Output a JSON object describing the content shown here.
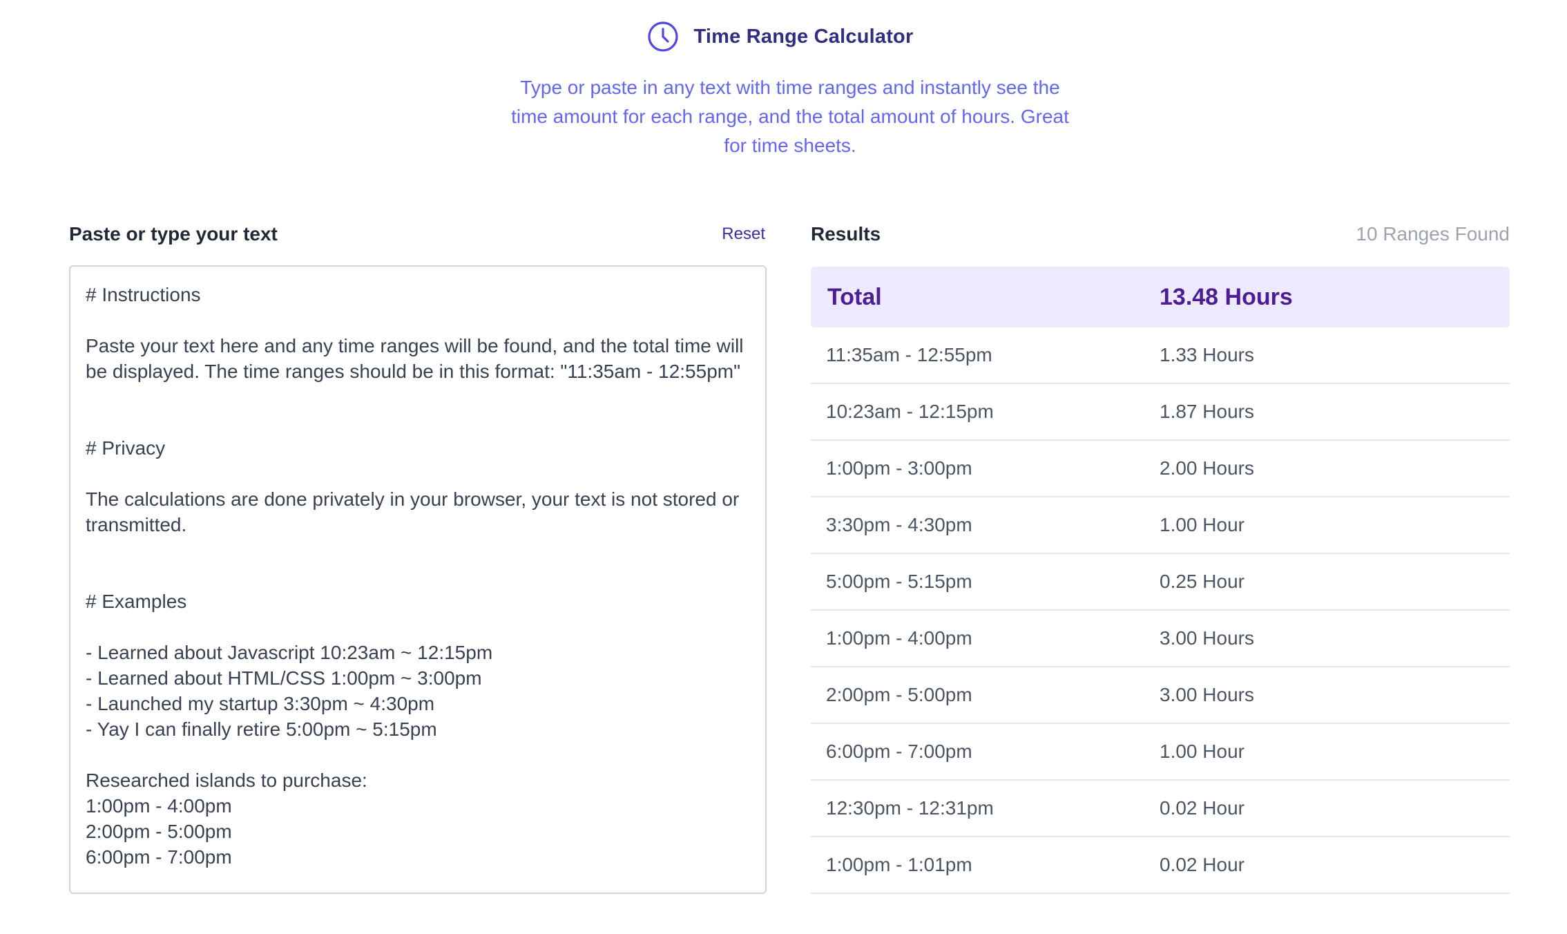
{
  "header": {
    "title": "Time Range Calculator",
    "subtitle": "Type or paste in any text with time ranges and instantly see the time amount for each range, and the total amount of hours. Great for time sheets.",
    "icon": "clock-icon",
    "accent_color": "#4f46e5"
  },
  "input_panel": {
    "title": "Paste or type your text",
    "reset_label": "Reset",
    "text": "# Instructions\n\nPaste your text here and any time ranges will be found, and the total time will be displayed. The time ranges should be in this format: \"11:35am - 12:55pm\"\n\n\n# Privacy\n\nThe calculations are done privately in your browser, your text is not stored or transmitted.\n\n\n# Examples\n\n- Learned about Javascript 10:23am ~ 12:15pm\n- Learned about HTML/CSS 1:00pm ~ 3:00pm\n- Launched my startup 3:30pm ~ 4:30pm\n- Yay I can finally retire 5:00pm ~ 5:15pm\n\nResearched islands to purchase:\n1:00pm - 4:00pm\n2:00pm - 5:00pm\n6:00pm - 7:00pm"
  },
  "results_panel": {
    "title": "Results",
    "ranges_found": "10 Ranges Found",
    "total_label": "Total",
    "total_value": "13.48 Hours",
    "rows": [
      {
        "range": "11:35am - 12:55pm",
        "amount": "1.33 Hours"
      },
      {
        "range": "10:23am - 12:15pm",
        "amount": "1.87 Hours"
      },
      {
        "range": "1:00pm - 3:00pm",
        "amount": "2.00 Hours"
      },
      {
        "range": "3:30pm - 4:30pm",
        "amount": "1.00 Hour"
      },
      {
        "range": "5:00pm - 5:15pm",
        "amount": "0.25 Hour"
      },
      {
        "range": "1:00pm - 4:00pm",
        "amount": "3.00 Hours"
      },
      {
        "range": "2:00pm - 5:00pm",
        "amount": "3.00 Hours"
      },
      {
        "range": "6:00pm - 7:00pm",
        "amount": "1.00 Hour"
      },
      {
        "range": "12:30pm - 12:31pm",
        "amount": "0.02 Hour"
      },
      {
        "range": "1:00pm - 1:01pm",
        "amount": "0.02 Hour"
      }
    ]
  }
}
